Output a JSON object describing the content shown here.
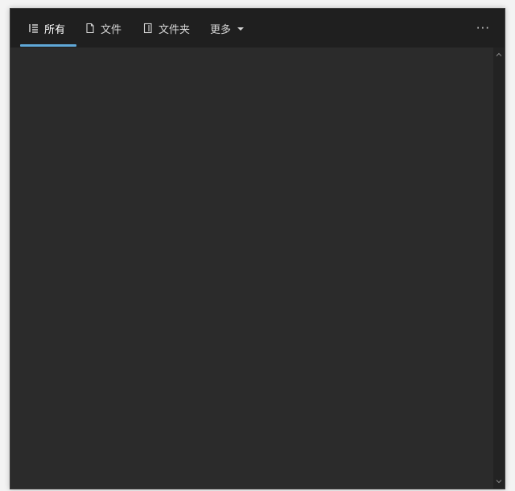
{
  "tabs": {
    "all_label": "所有",
    "files_label": "文件",
    "folders_label": "文件夹",
    "more_label": "更多"
  },
  "toolbar": {
    "overflow_label": "···"
  },
  "icons": {
    "all": "list-icon",
    "files": "file-icon",
    "folders": "folder-icon",
    "more": "caret-down-icon",
    "scroll_up": "chevron-up-icon",
    "scroll_down": "chevron-down-icon"
  },
  "colors": {
    "accent": "#60a8d8",
    "tabbar_bg": "#1f1f1f",
    "content_bg": "#2b2b2b"
  }
}
